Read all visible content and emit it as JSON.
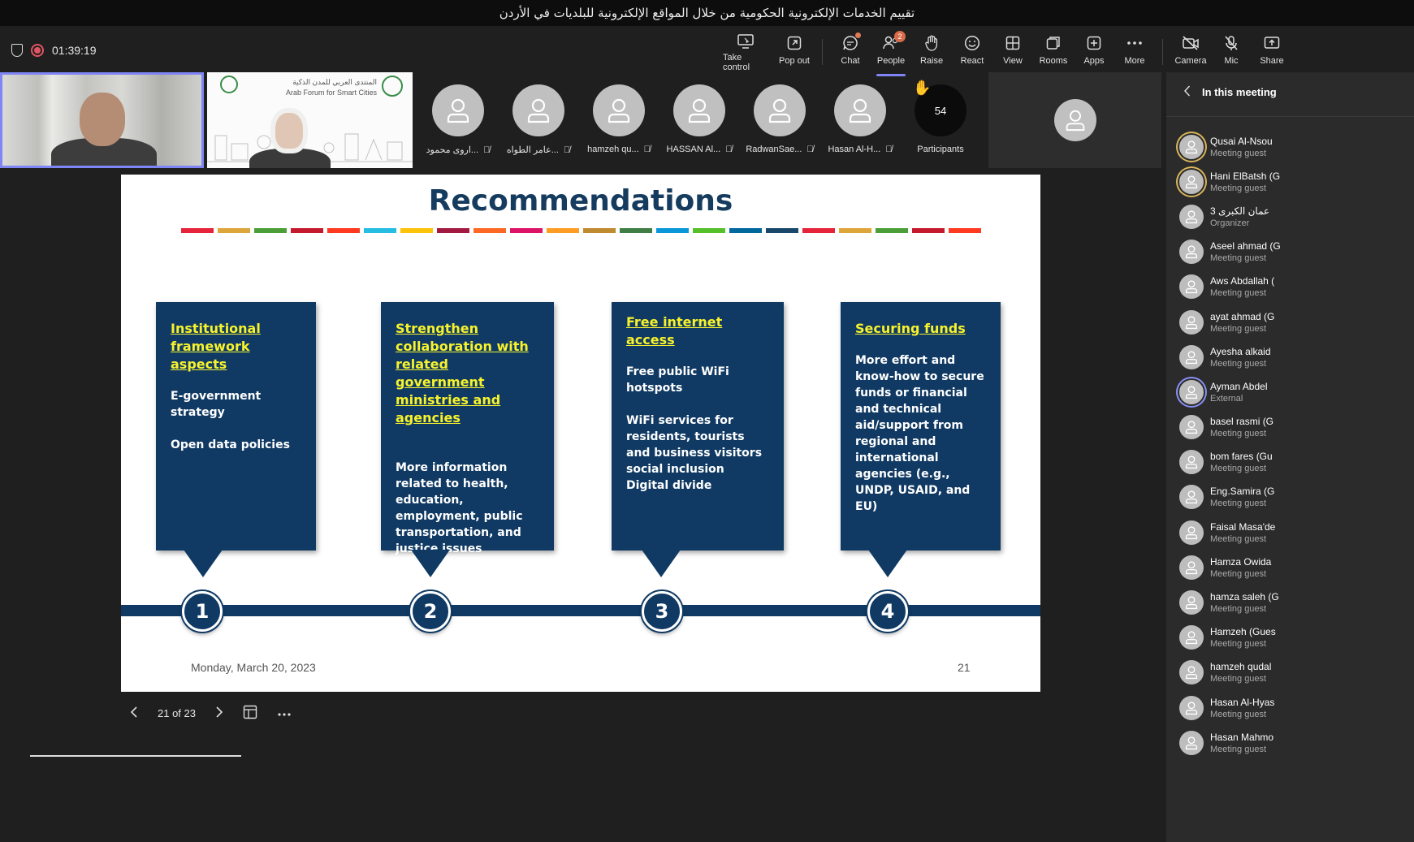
{
  "window": {
    "title": "تقييم الخدمات الإلكترونية الحكومية من خلال المواقع الإلكترونية للبلديات في الأردن"
  },
  "meeting": {
    "timer": "01:39:19"
  },
  "toolbar": {
    "take_control": "Take control",
    "pop_out": "Pop out",
    "chat": "Chat",
    "people": "People",
    "people_badge": "2",
    "raise": "Raise",
    "react": "React",
    "view": "View",
    "rooms": "Rooms",
    "apps": "Apps",
    "more": "More",
    "camera": "Camera",
    "mic": "Mic",
    "share": "Share"
  },
  "stage": {
    "video2_logo_ar": "المنتدى العربي للمدن الذكية",
    "video2_logo_en": "Arab Forum for Smart Cities",
    "participants": [
      {
        "name": "اروى محمود..."
      },
      {
        "name": "عامر الطواه..."
      },
      {
        "name": "hamzeh qu..."
      },
      {
        "name": "HASSAN Al..."
      },
      {
        "name": "RadwanSae..."
      },
      {
        "name": "Hasan Al-H..."
      }
    ],
    "participant_count": "54",
    "participant_count_label": "Participants"
  },
  "slide": {
    "title": "Recommendations",
    "sdg_colors": [
      "#e5243b",
      "#dda63a",
      "#4c9f38",
      "#c5192d",
      "#ff3a21",
      "#26bde2",
      "#fcc30b",
      "#a21942",
      "#fd6925",
      "#dd1367",
      "#fd9d24",
      "#bf8b2e",
      "#3f7e44",
      "#0a97d9",
      "#56c02b",
      "#00689d",
      "#19486a",
      "#e5243b",
      "#dda63a",
      "#4c9f38",
      "#c5192d",
      "#ff3a21"
    ],
    "cards": [
      {
        "number": "1",
        "heading": "Institutional framework aspects",
        "lines": [
          "E-government strategy",
          "Open data policies"
        ]
      },
      {
        "number": "2",
        "heading": "Strengthen collaboration with related government ministries and agencies",
        "lines": [
          "More information related to health, education, employment, public transportation, and justice issues"
        ]
      },
      {
        "number": "3",
        "heading": "Free internet access",
        "lines": [
          "Free public WiFi hotspots",
          "WiFi services for residents, tourists and business visitors\nsocial inclusion\nDigital divide"
        ]
      },
      {
        "number": "4",
        "heading": "Securing funds",
        "lines": [
          "More effort and know-how to secure funds or financial and technical aid/support from regional and international agencies (e.g., UNDP, USAID, and EU)"
        ]
      }
    ],
    "date": "Monday, March 20, 2023",
    "page": "21"
  },
  "slide_nav": {
    "position": "21 of 23"
  },
  "panel": {
    "title": "In this meeting",
    "people": [
      {
        "name": "Qusai Al-Nsou",
        "role": "Meeting guest",
        "ring": "y"
      },
      {
        "name": "Hani ElBatsh (G",
        "role": "Meeting guest",
        "ring": "y"
      },
      {
        "name": "3 عمان الكبرى",
        "role": "Organizer",
        "ring": ""
      },
      {
        "name": "Aseel ahmad (G",
        "role": "Meeting guest",
        "ring": ""
      },
      {
        "name": "Aws Abdallah (",
        "role": "Meeting guest",
        "ring": ""
      },
      {
        "name": "ayat ahmad (G",
        "role": "Meeting guest",
        "ring": ""
      },
      {
        "name": "Ayesha alkaid",
        "role": "Meeting guest",
        "ring": ""
      },
      {
        "name": "Ayman Abdel",
        "role": "External",
        "ring": "b"
      },
      {
        "name": "basel rasmi (G",
        "role": "Meeting guest",
        "ring": ""
      },
      {
        "name": "bom fares (Gu",
        "role": "Meeting guest",
        "ring": ""
      },
      {
        "name": "Eng.Samira (G",
        "role": "Meeting guest",
        "ring": ""
      },
      {
        "name": "Faisal Masa'de",
        "role": "Meeting guest",
        "ring": ""
      },
      {
        "name": "Hamza Owida",
        "role": "Meeting guest",
        "ring": ""
      },
      {
        "name": "hamza saleh (G",
        "role": "Meeting guest",
        "ring": ""
      },
      {
        "name": "Hamzeh (Gues",
        "role": "Meeting guest",
        "ring": ""
      },
      {
        "name": "hamzeh qudal",
        "role": "Meeting guest",
        "ring": ""
      },
      {
        "name": "Hasan Al-Hyas",
        "role": "Meeting guest",
        "ring": ""
      },
      {
        "name": "Hasan Mahmo",
        "role": "Meeting guest",
        "ring": ""
      }
    ]
  }
}
